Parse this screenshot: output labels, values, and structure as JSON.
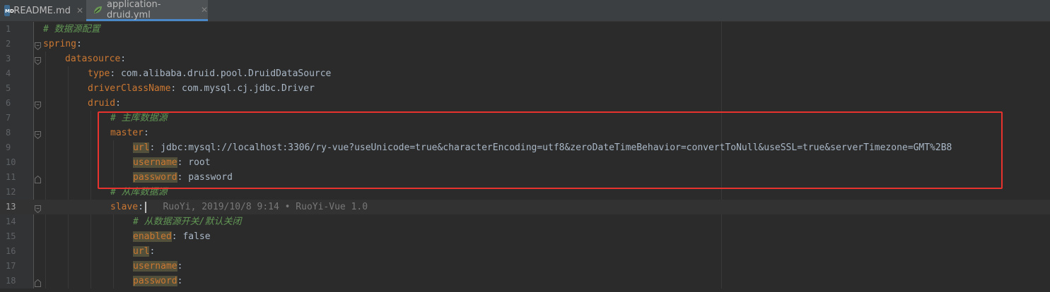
{
  "tabs": [
    {
      "label": "README.md",
      "icon": "markdown-file-icon",
      "active": false
    },
    {
      "label": "application-druid.yml",
      "icon": "yaml-file-icon",
      "active": true
    }
  ],
  "annotation_color": "#e8322d",
  "lines": [
    {
      "n": "1",
      "parts": [
        {
          "t": "# 数据源配置",
          "c": "c"
        }
      ]
    },
    {
      "n": "2",
      "parts": [
        {
          "t": "spring",
          "c": "k"
        },
        {
          "t": ":",
          "c": "v"
        }
      ]
    },
    {
      "n": "3",
      "parts": [
        {
          "t": "datasource",
          "c": "k"
        },
        {
          "t": ":",
          "c": "v"
        }
      ]
    },
    {
      "n": "4",
      "parts": [
        {
          "t": "type",
          "c": "k"
        },
        {
          "t": ": com.alibaba.druid.pool.DruidDataSource",
          "c": "v"
        }
      ]
    },
    {
      "n": "5",
      "parts": [
        {
          "t": "driverClassName",
          "c": "k"
        },
        {
          "t": ": com.mysql.cj.jdbc.Driver",
          "c": "v"
        }
      ]
    },
    {
      "n": "6",
      "parts": [
        {
          "t": "druid",
          "c": "k"
        },
        {
          "t": ":",
          "c": "v"
        }
      ]
    },
    {
      "n": "7",
      "parts": [
        {
          "t": "# 主库数据源",
          "c": "c"
        }
      ]
    },
    {
      "n": "8",
      "parts": [
        {
          "t": "master",
          "c": "k"
        },
        {
          "t": ":",
          "c": "v"
        }
      ]
    },
    {
      "n": "9",
      "parts": [
        {
          "t": "url",
          "c": "k hl"
        },
        {
          "t": ": jdbc:mysql://localhost:3306/ry-vue?useUnicode=true&characterEncoding=utf8&zeroDateTimeBehavior=convertToNull&useSSL=true&serverTimezone=GMT%2B8",
          "c": "v"
        }
      ]
    },
    {
      "n": "10",
      "parts": [
        {
          "t": "username",
          "c": "k hl"
        },
        {
          "t": ": root",
          "c": "v"
        }
      ]
    },
    {
      "n": "11",
      "parts": [
        {
          "t": "password",
          "c": "k hl"
        },
        {
          "t": ": password",
          "c": "v"
        }
      ]
    },
    {
      "n": "12",
      "parts": [
        {
          "t": "# 从库数据源",
          "c": "c"
        }
      ]
    },
    {
      "n": "13",
      "parts": [
        {
          "t": "slave",
          "c": "k"
        },
        {
          "t": ":",
          "c": "v"
        },
        {
          "t": "CARET",
          "c": "caret"
        },
        {
          "t": "   RuoYi, 2019/10/8 9:14 • RuoYi-Vue 1.0",
          "c": "ann"
        }
      ]
    },
    {
      "n": "14",
      "parts": [
        {
          "t": "# 从数据源开关/默认关闭",
          "c": "c"
        }
      ]
    },
    {
      "n": "15",
      "parts": [
        {
          "t": "enabled",
          "c": "k hl"
        },
        {
          "t": ": false",
          "c": "v"
        }
      ]
    },
    {
      "n": "16",
      "parts": [
        {
          "t": "url",
          "c": "k hl"
        },
        {
          "t": ":",
          "c": "v"
        }
      ]
    },
    {
      "n": "17",
      "parts": [
        {
          "t": "username",
          "c": "k hl"
        },
        {
          "t": ":",
          "c": "v"
        }
      ]
    },
    {
      "n": "18",
      "parts": [
        {
          "t": "password",
          "c": "k hl"
        },
        {
          "t": ":",
          "c": "v"
        }
      ]
    }
  ]
}
